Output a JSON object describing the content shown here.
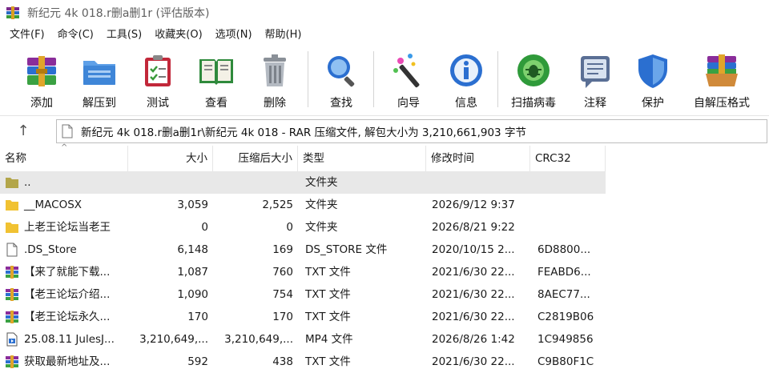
{
  "window": {
    "title": "新纪元 4k 018.r删a删1r (评估版本)"
  },
  "menu": [
    "文件(F)",
    "命令(C)",
    "工具(S)",
    "收藏夹(O)",
    "选项(N)",
    "帮助(H)"
  ],
  "toolbar": {
    "add": "添加",
    "extract_to": "解压到",
    "test": "测试",
    "view": "查看",
    "delete": "删除",
    "find": "查找",
    "wizard": "向导",
    "info": "信息",
    "scan": "扫描病毒",
    "comment": "注释",
    "protect": "保护",
    "sfx": "自解压格式"
  },
  "address": {
    "up_icon": "arrow-up-icon",
    "path": "新纪元 4k 018.r删a删1r\\新纪元 4k 018 - RAR 压缩文件, 解包大小为 3,210,661,903 字节"
  },
  "columns": {
    "name": "名称",
    "size": "大小",
    "packed": "压缩后大小",
    "type": "类型",
    "mtime": "修改时间",
    "crc": "CRC32"
  },
  "files": [
    {
      "name": "..",
      "size": "",
      "packed": "",
      "type": "文件夹",
      "mtime": "",
      "crc": "",
      "icon": "folder-icon"
    },
    {
      "name": "__MACOSX",
      "size": "3,059",
      "packed": "2,525",
      "type": "文件夹",
      "mtime": "2026/9/12 9:37",
      "crc": "",
      "icon": "folder-icon"
    },
    {
      "name": "上老王论坛当老王",
      "size": "0",
      "packed": "0",
      "type": "文件夹",
      "mtime": "2026/8/21 9:22",
      "crc": "",
      "icon": "folder-icon"
    },
    {
      "name": ".DS_Store",
      "size": "6,148",
      "packed": "169",
      "type": "DS_STORE 文件",
      "mtime": "2020/10/15 2...",
      "crc": "6D8800...",
      "icon": "file-icon"
    },
    {
      "name": "【来了就能下载...",
      "size": "1,087",
      "packed": "760",
      "type": "TXT 文件",
      "mtime": "2021/6/30 22...",
      "crc": "FEABD6...",
      "icon": "rar-icon"
    },
    {
      "name": "【老王论坛介绍...",
      "size": "1,090",
      "packed": "754",
      "type": "TXT 文件",
      "mtime": "2021/6/30 22...",
      "crc": "8AEC77...",
      "icon": "rar-icon"
    },
    {
      "name": "【老王论坛永久...",
      "size": "170",
      "packed": "170",
      "type": "TXT 文件",
      "mtime": "2021/6/30 22...",
      "crc": "C2819B06",
      "icon": "rar-icon"
    },
    {
      "name": "25.08.11 JulesJ...",
      "size": "3,210,649,...",
      "packed": "3,210,649,...",
      "type": "MP4 文件",
      "mtime": "2026/8/26 1:42",
      "crc": "1C949856",
      "icon": "video-file-icon"
    },
    {
      "name": "获取最新地址及...",
      "size": "592",
      "packed": "438",
      "type": "TXT 文件",
      "mtime": "2021/6/30 22...",
      "crc": "C9B80F1C",
      "icon": "rar-icon"
    }
  ]
}
